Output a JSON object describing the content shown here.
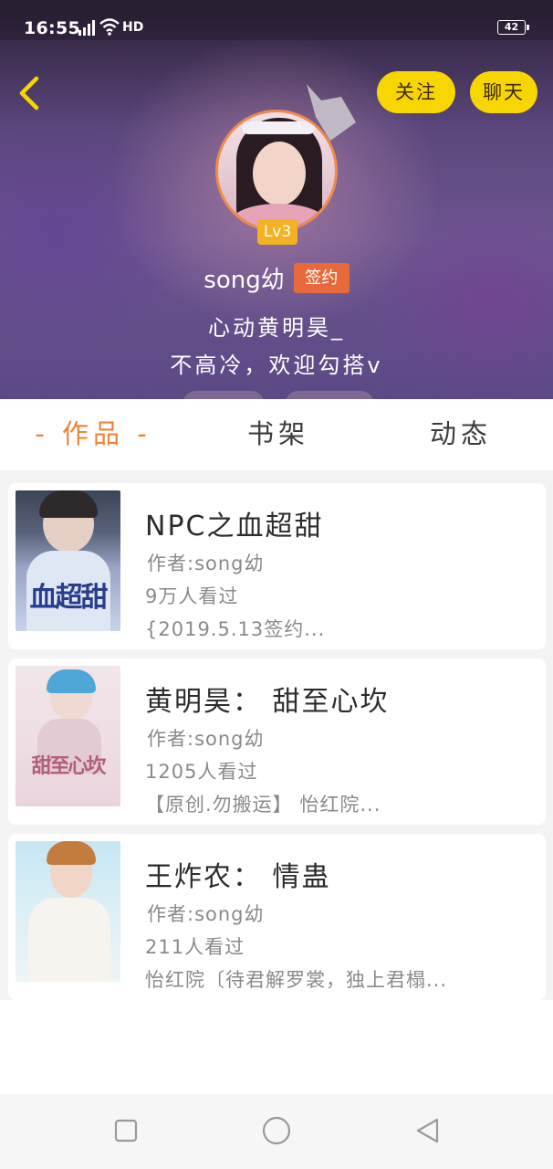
{
  "status_bar": {
    "time": "16:55",
    "network": "4G",
    "hd": "HD",
    "battery": "42"
  },
  "header": {
    "follow_label": "关注",
    "chat_label": "聊天",
    "level": "Lv3",
    "username": "song幼",
    "signed_badge": "签约",
    "bio_lines": [
      "心动黄明昊_",
      "不高冷，欢迎勾搭v"
    ]
  },
  "tabs": [
    {
      "label": "- 作品 -",
      "active": true
    },
    {
      "label": "书架",
      "active": false
    },
    {
      "label": "动态",
      "active": false
    }
  ],
  "books": [
    {
      "title": "NPC之血超甜",
      "author": "作者:song幼",
      "views": "9万人看过",
      "desc": "{2019.5.13签约...",
      "cover_text": "血超甜"
    },
    {
      "title": "黄明昊： 甜至心坎",
      "author": "作者:song幼",
      "views": "1205人看过",
      "desc": "【原创.勿搬运】 怡红院...",
      "cover_text": "甜至心坎"
    },
    {
      "title": "王炸农： 情蛊",
      "author": "作者:song幼",
      "views": "211人看过",
      "desc": "怡红院〔待君解罗裳，独上君榻...",
      "cover_text": ""
    }
  ],
  "colors": {
    "accent": "#f2813a",
    "button_yellow": "#f7d600",
    "signed_badge": "#e86a3c",
    "level_badge": "#f2b223"
  },
  "nav": [
    "square-icon",
    "circle-icon",
    "back-triangle-icon"
  ]
}
